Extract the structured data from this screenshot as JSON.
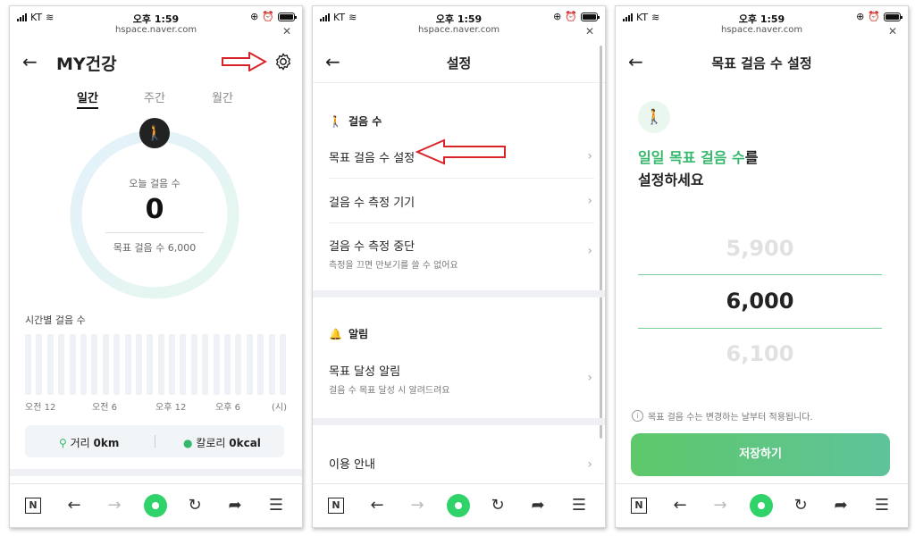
{
  "status": {
    "carrier": "KT",
    "time": "오후 1:59",
    "url": "hspace.naver.com"
  },
  "screen1": {
    "title": "MY건강",
    "tabs": [
      "일간",
      "주간",
      "월간"
    ],
    "today_label": "오늘 걸음 수",
    "today_steps": "0",
    "goal": "목표 걸음 수 6,000",
    "hourly_title": "시간별 걸음 수",
    "axis": [
      "오전 12",
      "오전 6",
      "오후 12",
      "오후 6",
      "(시)"
    ],
    "distance_label": "거리",
    "distance_value": "0km",
    "calorie_label": "칼로리",
    "calorie_value": "0kcal"
  },
  "screen2": {
    "title": "설정",
    "steps_section": "걸음 수",
    "rows": [
      {
        "title": "목표 걸음 수 설정"
      },
      {
        "title": "걸음 수 측정 기기"
      },
      {
        "title": "걸음 수 측정 중단",
        "sub": "측정을 끄면 만보기를 쓸 수 없어요"
      }
    ],
    "alarm_section": "알림",
    "alarm_row": {
      "title": "목표 달성 알림",
      "sub": "걸음 수 목표 달성 시 알려드려요"
    },
    "info_row": "이용 안내"
  },
  "screen3": {
    "title": "목표 걸음 수 설정",
    "headline_green": "일일 목표 걸음 수",
    "headline_rest1": "를",
    "headline_line2": "설정하세요",
    "picker_prev": "5,900",
    "picker_selected": "6,000",
    "picker_next": "6,100",
    "note": "목표 걸음 수는 변경하는 날부터 적용됩니다.",
    "save": "저장하기"
  },
  "nav": {
    "home_label": "N"
  },
  "colors": {
    "accent_green": "#35b86b",
    "nav_green": "#2fd36a",
    "annotation_red": "#d9252a"
  }
}
